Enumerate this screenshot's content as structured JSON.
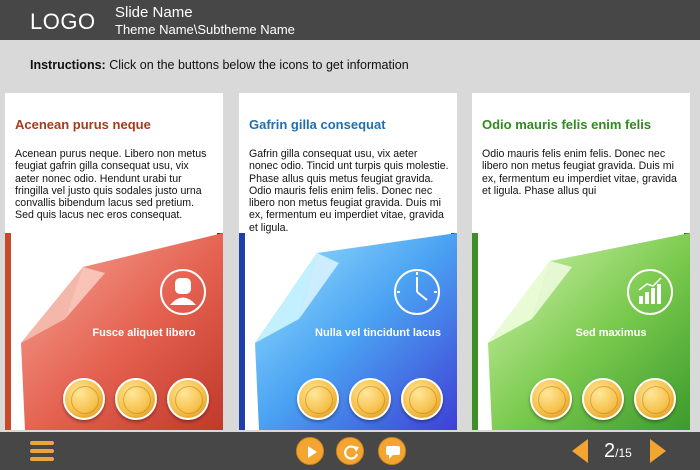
{
  "header": {
    "logo": "LOGO",
    "slide_name": "Slide Name",
    "theme_name": "Theme Name\\Subtheme Name"
  },
  "instructions": {
    "label": "Instructions:",
    "text": "Click on the buttons below the icons to get information"
  },
  "cards": [
    {
      "title": "Acenean purus neque",
      "title_color": "#a43b1c",
      "text": "Acenean purus neque. Libero non metus feugiat gafrin gilla consequat usu, vix aeter nonec odio. Hendunt urabi tur fringilla vel justo quis sodales justo urna convallis bibendum lacus sed pretium. Sed quis lacus nec eros consequat.",
      "caption": "Fusce aliquet libero",
      "icon": "user-icon",
      "accent": "#d9534f"
    },
    {
      "title": "Gafrin gilla consequat",
      "title_color": "#1f6fb2",
      "text": "Gafrin gilla consequat usu, vix aeter nonec odio. Tincid unt turpis quis molestie. Phase allus quis metus feugiat gravida. Odio mauris felis enim felis. Donec nec libero non metus feugiat gravida. Duis mi ex, fermentum eu imperdiet vitae, gravida et ligula.",
      "caption": "Nulla vel tincidunt lacus",
      "icon": "clock-icon",
      "accent": "#3a6fd8"
    },
    {
      "title": "Odio mauris felis enim felis",
      "title_color": "#2e8b1e",
      "text": "Odio mauris felis enim felis. Donec nec libero non metus feugiat gravida. Duis mi ex, fermentum eu imperdiet vitae, gravida et ligula. Phase allus qui",
      "caption": "Sed maximus",
      "icon": "bar-chart-icon",
      "accent": "#5cb83a"
    }
  ],
  "footer": {
    "menu_icon": "menu-icon",
    "play_icon": "play-icon",
    "replay_icon": "replay-icon",
    "comment_icon": "comment-icon",
    "current_page": "2",
    "total_pages": "/15"
  }
}
